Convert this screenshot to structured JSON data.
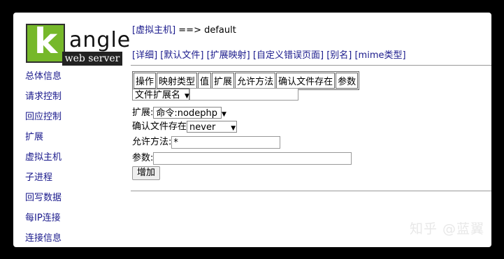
{
  "logo": {
    "letter": "k",
    "word": "angle",
    "tagline": "web server"
  },
  "sidebar": {
    "items": [
      {
        "label": "总体信息"
      },
      {
        "label": "请求控制"
      },
      {
        "label": "回应控制"
      },
      {
        "label": "扩展"
      },
      {
        "label": "虚拟主机"
      },
      {
        "label": "子进程"
      },
      {
        "label": "回写数据"
      },
      {
        "label": "每IP连接"
      },
      {
        "label": "连接信息"
      }
    ]
  },
  "breadcrumb": {
    "link": "[虚拟主机]",
    "arrow": " ==> ",
    "current": "default"
  },
  "tabs": [
    {
      "label": "[详细]"
    },
    {
      "label": "[默认文件]"
    },
    {
      "label": "[扩展映射]"
    },
    {
      "label": "[自定义错误页面]"
    },
    {
      "label": "[别名]"
    },
    {
      "label": "[mime类型]"
    }
  ],
  "table": {
    "headers": [
      "操作",
      "映射类型",
      "值",
      "扩展",
      "允许方法",
      "确认文件存在",
      "参数"
    ]
  },
  "form": {
    "map_type_select": "文件扩展名",
    "map_type_value": "",
    "extend_label": "扩展:",
    "extend_select": "命令:nodephp",
    "confirm_label": "确认文件存在",
    "confirm_select": "never",
    "methods_label": "允许方法:",
    "methods_value": "*",
    "params_label": "参数:",
    "params_value": "",
    "add_button": "增加"
  },
  "watermark": "知乎 @蓝翼"
}
